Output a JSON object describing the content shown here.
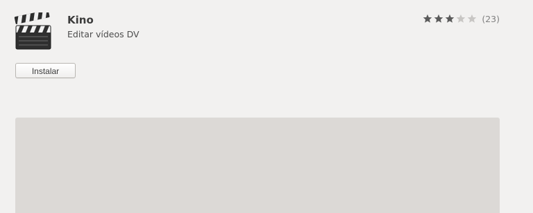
{
  "app": {
    "name": "Kino",
    "summary": "Editar vídeos DV",
    "icon": "clapperboard-icon"
  },
  "rating": {
    "stars": 3,
    "max_stars": 5,
    "review_count_label": "(23)",
    "filled_color": "#5a5a5a",
    "empty_color": "#c8c6c4"
  },
  "actions": {
    "install_label": "Instalar"
  },
  "colors": {
    "background": "#f2f1f0",
    "screenshot_placeholder": "#dcd9d6"
  }
}
